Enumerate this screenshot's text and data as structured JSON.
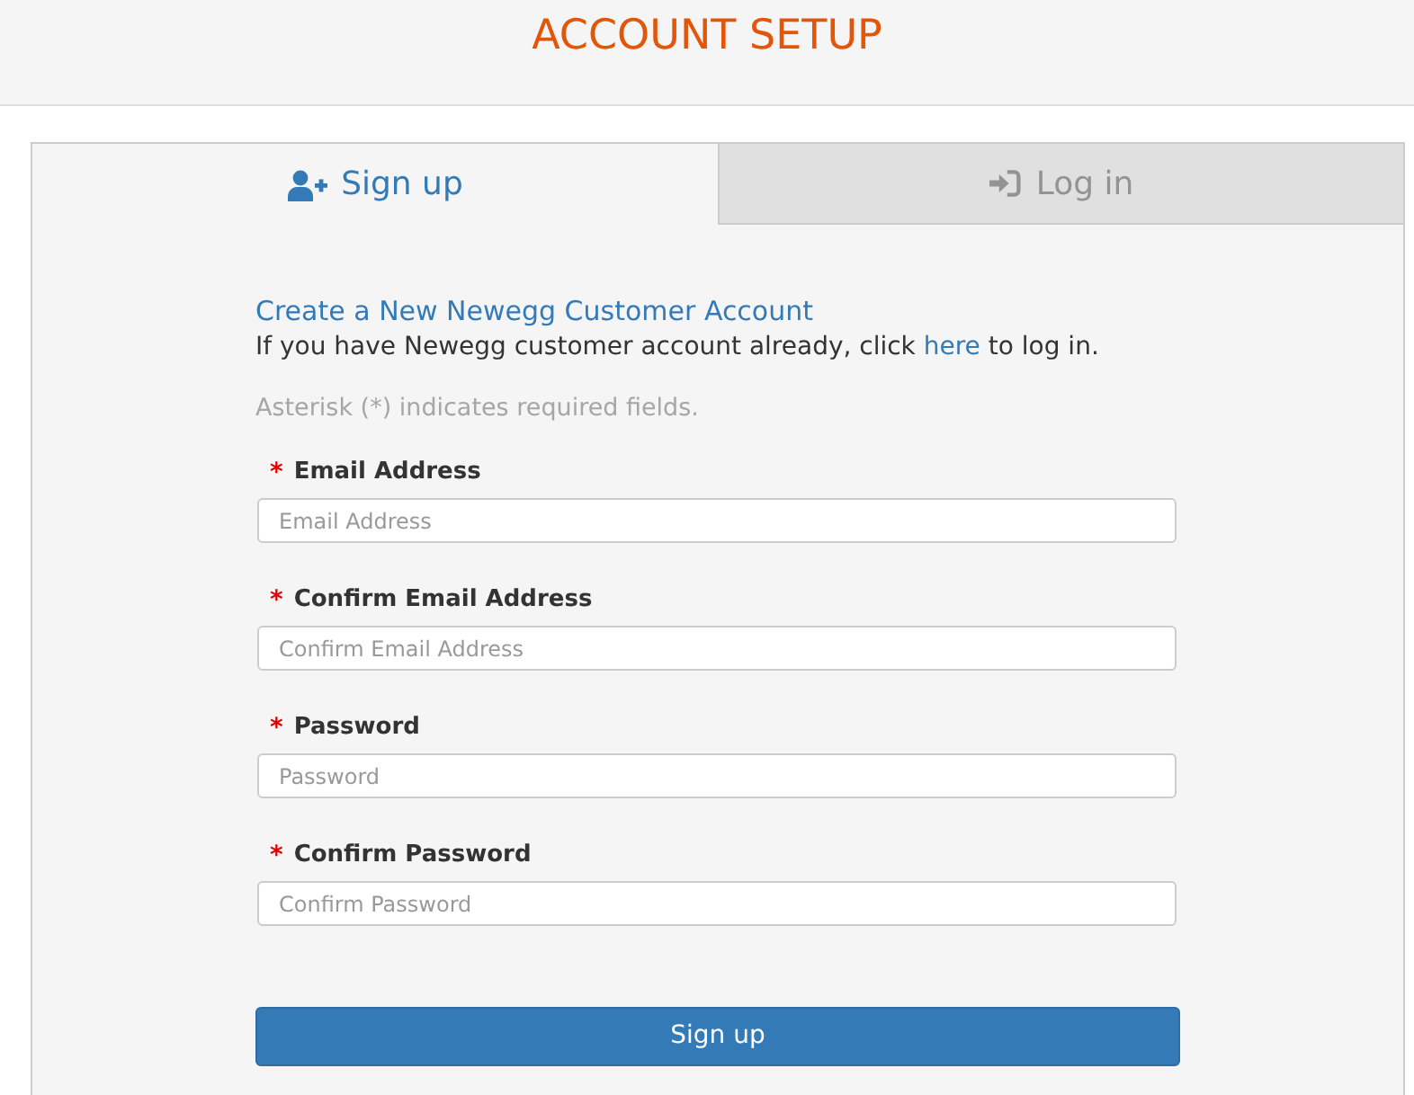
{
  "header": {
    "title": "ACCOUNT SETUP"
  },
  "tabs": [
    {
      "kind": "signup",
      "label": "Sign up",
      "selected": true
    },
    {
      "kind": "login",
      "label": "Log in",
      "selected": false
    }
  ],
  "form": {
    "heading": "Create a New Newegg Customer Account",
    "intro": {
      "before": "If you have Newegg customer account already, click ",
      "link": "here",
      "after": " to log in."
    },
    "note": "Asterisk (*) indicates required fields.",
    "fields": [
      {
        "required_mark": "*",
        "label": "Email Address",
        "placeholder": "Email Address"
      },
      {
        "required_mark": "*",
        "label": "Confirm Email Address",
        "placeholder": "Confirm Email Address"
      },
      {
        "required_mark": "*",
        "label": "Password",
        "placeholder": "Password"
      },
      {
        "required_mark": "*",
        "label": "Confirm Password",
        "placeholder": "Confirm Password"
      }
    ],
    "submit": "Sign up"
  }
}
